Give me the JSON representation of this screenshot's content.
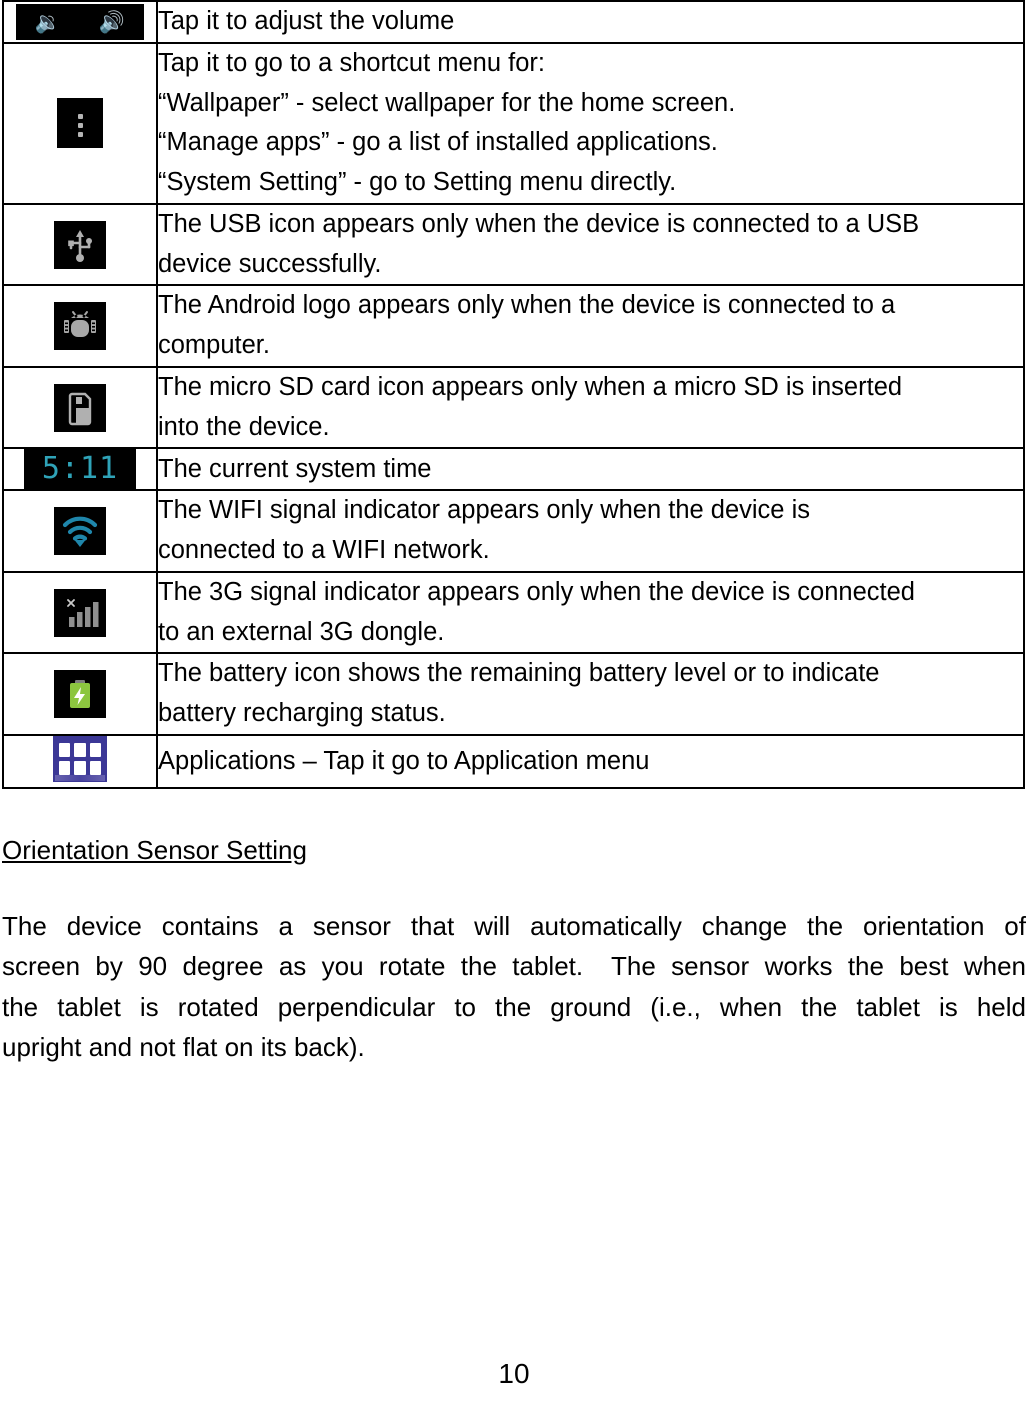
{
  "page": {
    "number": "10"
  },
  "table": {
    "rows": [
      {
        "icon": "volume-icon",
        "icon_glyphs": [
          "ὐ9",
          "ὐA"
        ],
        "lines": [
          "Tap it to adjust the volume"
        ]
      },
      {
        "icon": "overflow-menu-icon",
        "lines": [
          "Tap it to go to a shortcut menu for:",
          "“Wallpaper” - select wallpaper for the home screen.",
          "“Manage apps” - go a list of installed applications.",
          "“System Setting” - go to Setting menu directly."
        ]
      },
      {
        "icon": "usb-icon",
        "lines": [
          "The USB icon appears only when the device is connected to a USB",
          "device successfully."
        ]
      },
      {
        "icon": "android-bug-icon",
        "lines": [
          "The Android logo appears only when the device is connected to a",
          "computer."
        ]
      },
      {
        "icon": "micro-sd-card-icon",
        "lines": [
          "The micro SD card icon appears only when a micro SD is inserted",
          "into the device."
        ]
      },
      {
        "icon": "clock-icon",
        "icon_text": "5:11",
        "lines": [
          "The current system time"
        ]
      },
      {
        "icon": "wifi-icon",
        "lines": [
          "The WIFI signal indicator appears only when the device is",
          "connected to a WIFI network."
        ]
      },
      {
        "icon": "signal-3g-icon",
        "lines": [
          "The 3G signal indicator appears only when the device is connected",
          "to an external 3G dongle."
        ]
      },
      {
        "icon": "battery-charging-icon",
        "lines": [
          "The battery icon shows the remaining battery level or to indicate",
          "battery recharging status."
        ]
      },
      {
        "icon": "applications-icon",
        "lines": [
          "Applications – Tap it go to Application menu"
        ]
      }
    ]
  },
  "section": {
    "heading": "Orientation Sensor Setting",
    "paragraph_lines": [
      "The device contains a sensor that will automatically change the orientation of",
      "screen by 90 degree as you rotate the tablet.  The sensor works the best when",
      "the tablet is rotated perpendicular to the ground (i.e., when the tablet is held",
      "upright and not flat on its back)."
    ]
  },
  "colors": {
    "icon_background": "#000000",
    "icon_foreground": "#b5b5b5",
    "clock_text": "#2fa3b8",
    "wifi": "#1d7fa3",
    "battery": "#8cc63f",
    "applications_background": "#3b3796",
    "text": "#000000"
  }
}
